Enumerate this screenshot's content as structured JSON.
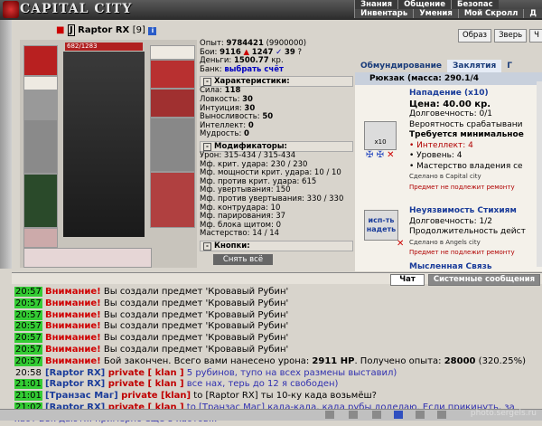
{
  "app": {
    "logo": "CAPITAL CITY"
  },
  "topnav": {
    "row1": [
      "Знания",
      "Общение",
      "Безопас"
    ],
    "row2": [
      "Инвентарь",
      "Умения",
      "Мой Скролл",
      "Д"
    ]
  },
  "character": {
    "name": "Raptor RX",
    "level": "[9]",
    "info_icon": "i",
    "hp": "682/1283"
  },
  "stats": {
    "experience": "9784421",
    "experience_next": "(9900000)",
    "fights": "9116",
    "wins": "1247",
    "losses": "39",
    "money": "1500.77",
    "money_unit": "кр.",
    "bank_label": "Банк:",
    "bank_link": "выбрать счёт",
    "labels": {
      "exp": "Опыт:",
      "fights": "Бои:",
      "money": "Деньги:"
    },
    "characteristics_title": "Характеристики:",
    "characteristics": [
      {
        "label": "Сила:",
        "value": "118"
      },
      {
        "label": "Ловкость:",
        "value": "30"
      },
      {
        "label": "Интуиция:",
        "value": "30"
      },
      {
        "label": "Выносливость:",
        "value": "50"
      },
      {
        "label": "Интеллект:",
        "value": "0"
      },
      {
        "label": "Мудрость:",
        "value": "0"
      }
    ],
    "modifiers_title": "Модификаторы:",
    "modifiers": [
      "Урон: 315-434 / 315-434",
      "Мф. крит. удара: 230 / 230",
      "Мф. мощности крит. удара: 10 / 10",
      "Мф. против крит. удара: 615",
      "Мф. увертывания: 150",
      "Мф. против увертывания: 330 / 330",
      "Мф. контрудара: 10",
      "Мф. парирования: 37",
      "Мф. блока щитом: 0",
      "Мастерство: 14 / 14"
    ],
    "buttons_title": "Кнопки:",
    "take_off_all": "Снять всё"
  },
  "right_buttons": [
    "Образ",
    "Зверь",
    "Ч"
  ],
  "tabs": [
    {
      "label": "Обмундирование"
    },
    {
      "label": "Заклятия"
    },
    {
      "label": "Г"
    }
  ],
  "rucksack": {
    "title": "Рюкзак (масса: 290.1/4"
  },
  "items": [
    {
      "icon_label": "x10",
      "title": "Нападение (x10)",
      "price": "Цена: 40.00 кр.",
      "durability": "Долговечность: 0/1",
      "line3": "Вероятность срабатывани",
      "requirements": "Требуется минимальное",
      "req1": "• Интеллект: 4",
      "req2": "• Уровень: 4",
      "req3": "• Мастерство владения се",
      "made": "Сделано в Capital city",
      "norepair": "Предмет не подлежит ремонту"
    },
    {
      "icon_label": "исп-ть надеть",
      "title": "Неуязвимость Стихиям",
      "durability": "Долговечность: 1/2",
      "line3": "Продолжительность дейст",
      "made": "Сделано в Angels city",
      "norepair": "Предмет не подлежит ремонту"
    },
    {
      "title": "Мысленная Связь"
    }
  ],
  "chat_tabs": [
    "Чат",
    "Системные сообщения"
  ],
  "chat": [
    {
      "time": "20:57",
      "type": "warn",
      "label": "Внимание!",
      "text": " Вы создали предмет 'Кровавый Рубин'"
    },
    {
      "time": "20:57",
      "type": "warn",
      "label": "Внимание!",
      "text": " Вы создали предмет 'Кровавый Рубин'"
    },
    {
      "time": "20:57",
      "type": "warn",
      "label": "Внимание!",
      "text": " Вы создали предмет 'Кровавый Рубин'"
    },
    {
      "time": "20:57",
      "type": "warn",
      "label": "Внимание!",
      "text": " Вы создали предмет 'Кровавый Рубин'"
    },
    {
      "time": "20:57",
      "type": "warn",
      "label": "Внимание!",
      "text": " Вы создали предмет 'Кровавый Рубин'"
    },
    {
      "time": "20:57",
      "type": "warn",
      "label": "Внимание!",
      "text": " Вы создали предмет 'Кровавый Рубин'"
    },
    {
      "time": "20:57",
      "type": "battle",
      "label": "Внимание!",
      "text": " Бой закончен. Всего вами нанесено урона: ",
      "b1": "2911 HP",
      "mid": ". Получено опыта: ",
      "b2": "28000",
      "end": " (320.25%)"
    },
    {
      "time": "20:58",
      "plain": true,
      "nick": "[Raptor RX]",
      "priv": " private [ klan ]",
      "msg": " 5 рубинов, тупо на всех размены выставил)"
    },
    {
      "time": "21:01",
      "nick": "[Raptor RX]",
      "priv": " private [ klan ]",
      "msg": " все нах, терь до 12 я свободен)"
    },
    {
      "time": "21:01",
      "nick": "[Транзас Маг]",
      "priv": " private [klan]",
      "msg": " to [Raptor RX] ты 10-ку када возьмёш?",
      "dark": true
    },
    {
      "time": "21:02",
      "nick": "[Raptor RX]",
      "priv": " private [ klan ]",
      "msg": " to [Транзас Маг] када-када, када рубы доделаю. Если прикинуть, за"
    },
    {
      "cont": "хаот 28к дают... примерно еще 8 хаотов..."
    }
  ],
  "watermark": "photo.sergels.ru"
}
